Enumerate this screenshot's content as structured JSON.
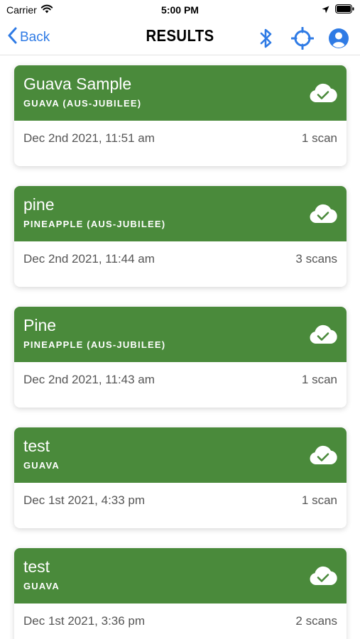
{
  "status_bar": {
    "carrier": "Carrier",
    "time": "5:00 PM"
  },
  "nav": {
    "back_label": "Back",
    "title": "RESULTS"
  },
  "colors": {
    "accent": "#2f7be5",
    "card_header": "#4a8a3b"
  },
  "icons": {
    "bluetooth": "bluetooth-icon",
    "locate": "crosshair-icon",
    "account": "account-icon",
    "sync": "cloud-check-icon"
  },
  "results": [
    {
      "title": "Guava Sample",
      "subtitle": "GUAVA (AUS-JUBILEE)",
      "date": "Dec 2nd 2021, 11:51 am",
      "scans": "1 scan"
    },
    {
      "title": "pine",
      "subtitle": "PINEAPPLE (AUS-JUBILEE)",
      "date": "Dec 2nd 2021, 11:44 am",
      "scans": "3 scans"
    },
    {
      "title": "Pine",
      "subtitle": "PINEAPPLE (AUS-JUBILEE)",
      "date": "Dec 2nd 2021, 11:43 am",
      "scans": "1 scan"
    },
    {
      "title": "test",
      "subtitle": "GUAVA",
      "date": "Dec 1st 2021, 4:33 pm",
      "scans": "1 scan"
    },
    {
      "title": "test",
      "subtitle": "GUAVA",
      "date": "Dec 1st 2021, 3:36 pm",
      "scans": "2 scans"
    }
  ]
}
